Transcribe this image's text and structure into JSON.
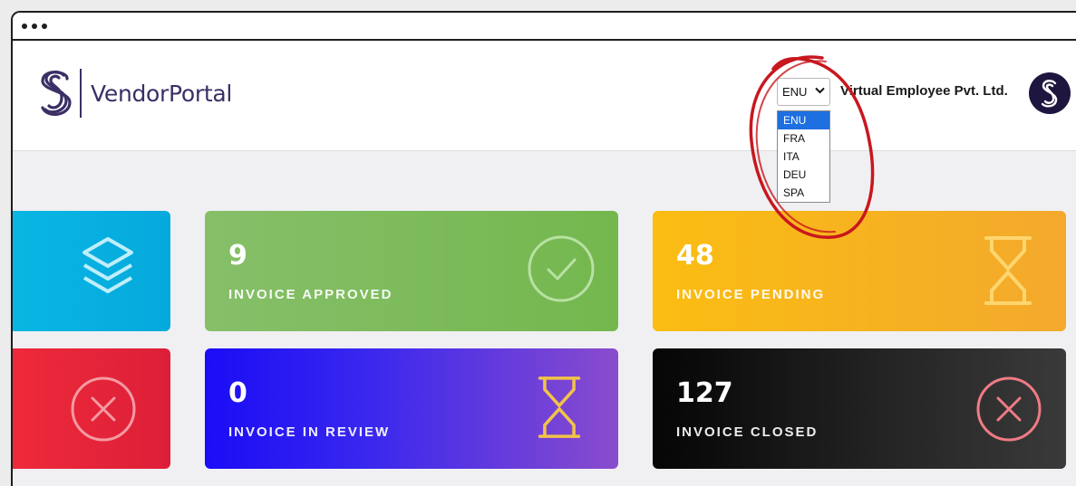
{
  "window": {
    "controls": [
      "•",
      "•",
      "•"
    ]
  },
  "header": {
    "brand": "VendorPortal",
    "language": {
      "selected": "ENU",
      "options": [
        "ENU",
        "FRA",
        "ITA",
        "DEU",
        "SPA"
      ]
    },
    "company": "Virtual Employee Pvt. Ltd."
  },
  "cards": [
    {
      "id": "total",
      "value": "",
      "label": "",
      "icon": "layers-icon",
      "color": "#08aee0"
    },
    {
      "id": "approved",
      "value": "9",
      "label": "INVOICE APPROVED",
      "icon": "check-circle-icon",
      "color": "#7dbb5c"
    },
    {
      "id": "pending",
      "value": "48",
      "label": "INVOICE PENDING",
      "icon": "hourglass-icon",
      "color": "#f8b61e"
    },
    {
      "id": "rejected",
      "value": "",
      "label": "",
      "icon": "close-circle-icon",
      "color": "#e8263a"
    },
    {
      "id": "review",
      "value": "0",
      "label": "INVOICE IN REVIEW",
      "icon": "hourglass-icon",
      "color": "#1f10f0"
    },
    {
      "id": "closed",
      "value": "127",
      "label": "INVOICE CLOSED",
      "icon": "close-circle-icon",
      "color": "#111111"
    }
  ],
  "annotation": {
    "shape": "red-ellipse",
    "color": "#c8171e"
  }
}
